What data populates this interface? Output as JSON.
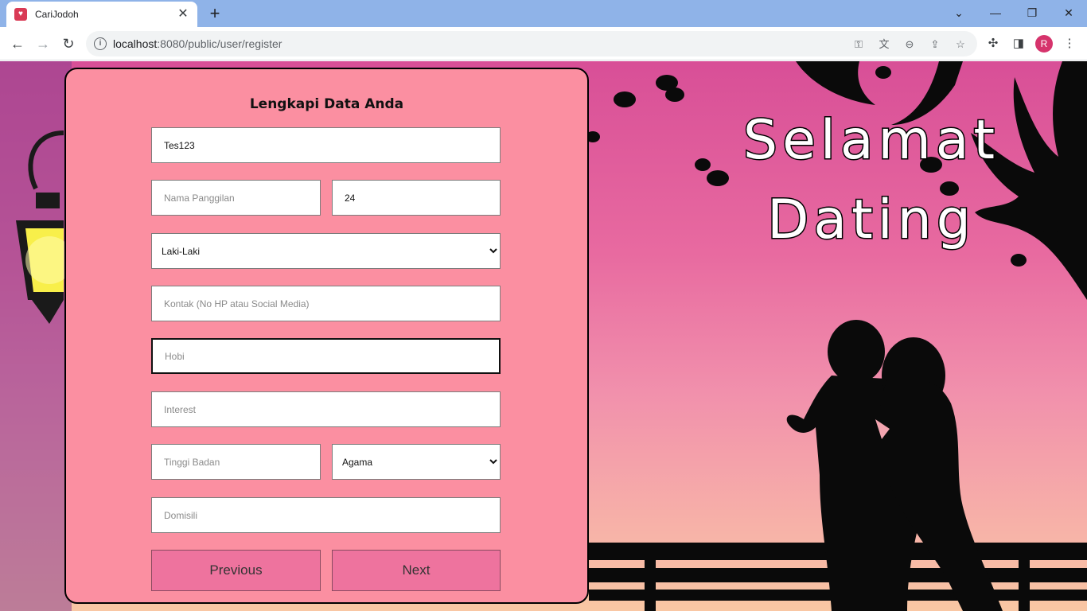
{
  "browser": {
    "tab_title": "CariJodoh",
    "tab_close": "✕",
    "new_tab": "+",
    "url_host": "localhost",
    "url_rest": ":8080/public/user/register",
    "window_controls": {
      "minimize": "—",
      "restore": "❐",
      "close": "✕",
      "tab_search": "⌄"
    },
    "nav": {
      "back": "←",
      "forward": "→",
      "reload": "↻"
    },
    "profile_initial": "R"
  },
  "hero": {
    "line1": "Selamat",
    "line2": "Dating"
  },
  "form": {
    "title": "Lengkapi Data Anda",
    "full_name": {
      "value": "Tes123",
      "placeholder": ""
    },
    "nickname": {
      "value": "",
      "placeholder": "Nama Panggilan"
    },
    "age": {
      "value": "24",
      "placeholder": ""
    },
    "gender": {
      "selected": "Laki-Laki"
    },
    "contact": {
      "value": "",
      "placeholder": "Kontak (No HP atau Social Media)"
    },
    "hobby": {
      "value": "",
      "placeholder": "Hobi"
    },
    "interest": {
      "value": "",
      "placeholder": "Interest"
    },
    "height": {
      "value": "",
      "placeholder": "Tinggi Badan"
    },
    "religion": {
      "selected": "Agama"
    },
    "domicile": {
      "value": "",
      "placeholder": "Domisili"
    },
    "previous_label": "Previous",
    "next_label": "Next"
  },
  "colors": {
    "card_bg": "#fb8fa1",
    "button_bg": "#ee739e",
    "tabbar_bg": "#8fb3e8"
  }
}
